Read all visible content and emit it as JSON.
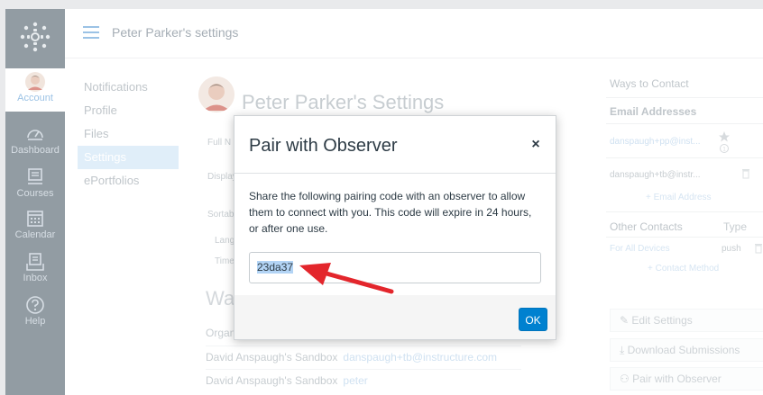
{
  "nav": {
    "items": [
      {
        "id": "account",
        "label": "Account",
        "icon": "avatar-icon"
      },
      {
        "id": "dashboard",
        "label": "Dashboard",
        "icon": "dashboard-icon"
      },
      {
        "id": "courses",
        "label": "Courses",
        "icon": "courses-icon"
      },
      {
        "id": "calendar",
        "label": "Calendar",
        "icon": "calendar-icon"
      },
      {
        "id": "inbox",
        "label": "Inbox",
        "icon": "inbox-icon"
      },
      {
        "id": "help",
        "label": "Help",
        "icon": "help-icon"
      }
    ]
  },
  "header": {
    "breadcrumb": "Peter Parker's settings"
  },
  "section_nav": {
    "items": [
      {
        "label": "Notifications",
        "active": false
      },
      {
        "label": "Profile",
        "active": false
      },
      {
        "label": "Files",
        "active": false
      },
      {
        "label": "Settings",
        "active": true
      },
      {
        "label": "ePortfolios",
        "active": false
      }
    ]
  },
  "content": {
    "title": "Peter Parker's Settings",
    "field_labels": [
      "Full N",
      "Display",
      "Sortable",
      "Lang",
      "Time"
    ],
    "ways_title": "Way",
    "org_header": "Organ",
    "rows": [
      {
        "name": "David Anspaugh's Sandbox",
        "link": "danspaugh+tb@instructure.com"
      },
      {
        "name": "David Anspaugh's Sandbox",
        "link": "peter"
      }
    ]
  },
  "right": {
    "ways_to_contact": "Ways to Contact",
    "email_addresses": "Email Addresses",
    "emails": [
      "danspaugh+pp@inst...",
      "danspaugh+tb@instr..."
    ],
    "add_email": "Email Address",
    "other_contacts": "Other Contacts",
    "type_label": "Type",
    "contact_name": "For All Devices",
    "contact_type": "push",
    "add_contact": "Contact Method",
    "buttons": [
      "Edit Settings",
      "Download Submissions",
      "Pair with Observer"
    ]
  },
  "modal": {
    "title": "Pair with Observer",
    "close": "×",
    "body": "Share the following pairing code with an observer to allow them to connect with you. This code will expire in 24 hours, or after one use.",
    "code": "23da37",
    "ok_label": "OK"
  },
  "colors": {
    "nav_bg": "#394b58",
    "accent": "#0081d0",
    "annotation_arrow": "#e3262c"
  }
}
